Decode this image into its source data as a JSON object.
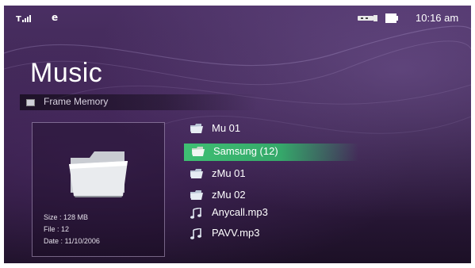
{
  "status_bar": {
    "signal_icon": "signal-strength-icon",
    "network_icon": "edge-network-icon",
    "network_glyph": "e",
    "usb_icon": "usb-connection-icon",
    "battery_icon": "battery-icon",
    "time": "10:16 am"
  },
  "page": {
    "title": "Music",
    "storage_label": "Frame Memory"
  },
  "info_panel": {
    "icon": "folder-icon",
    "size": "Size : 128 MB",
    "file": "File : 12",
    "date": "Date : 11/10/2006"
  },
  "file_list": {
    "items": [
      {
        "label": "Mu 01",
        "icon": "folder-icon"
      },
      {
        "label": "Samsung (12)",
        "icon": "folder-icon",
        "selected": true
      },
      {
        "label": "zMu 01",
        "icon": "folder-icon"
      },
      {
        "label": "zMu 02",
        "icon": "folder-icon"
      },
      {
        "label": "Anycall.mp3",
        "icon": "music-note-icon"
      },
      {
        "label": "PAVV.mp3",
        "icon": "music-note-icon"
      }
    ]
  },
  "colors": {
    "background": "#3b244f",
    "selection": "#3fbf73",
    "text": "#ffffff"
  }
}
